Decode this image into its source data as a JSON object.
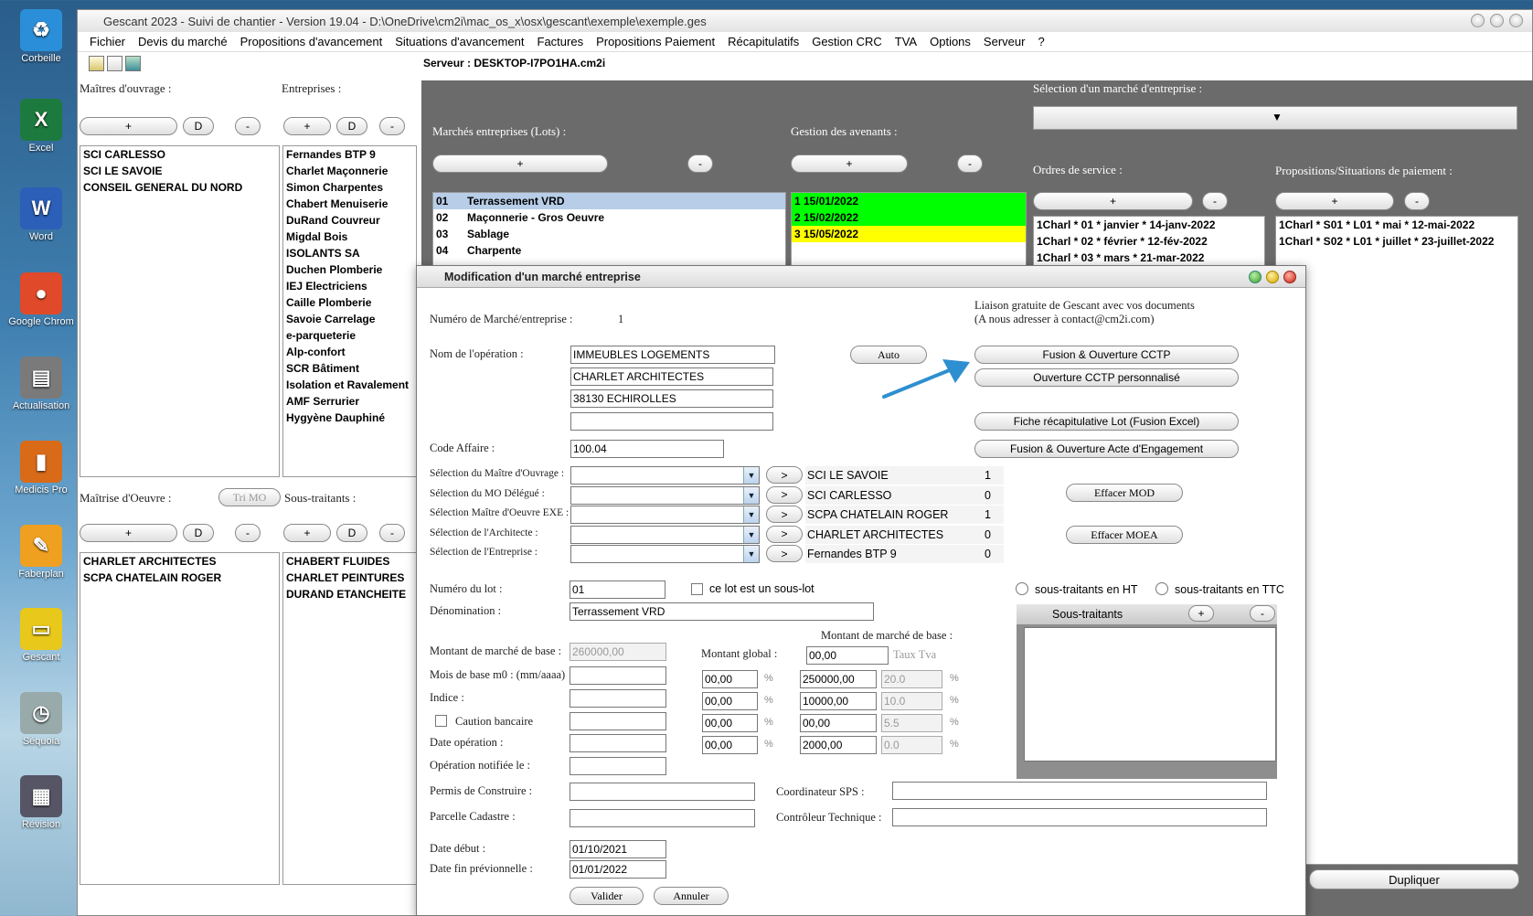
{
  "desktop": {
    "icons": [
      "Corbeille",
      "Excel",
      "Word",
      "Google Chrom",
      "Actualisation",
      "Medicis Pro",
      "Faberplan",
      "Gescant",
      "Séquoia",
      "Révision"
    ]
  },
  "window": {
    "title": "Gescant 2023 - Suivi de chantier - Version 19.04 - D:\\OneDrive\\cm2i\\mac_os_x\\osx\\gescant\\exemple\\exemple.ges"
  },
  "menu": [
    "Fichier",
    "Devis du marché",
    "Propositions d'avancement",
    "Situations d'avancement",
    "Factures",
    "Propositions Paiement",
    "Récapitulatifs",
    "Gestion CRC",
    "TVA",
    "Options",
    "Serveur",
    "?"
  ],
  "server": "Serveur : DESKTOP-I7PO1HA.cm2i",
  "left": {
    "maitres_label": "Maîtres d'ouvrage :",
    "entreprises_label": "Entreprises :",
    "plus": "+",
    "d": "D",
    "minus": "-",
    "maitres": [
      "SCI CARLESSO",
      "SCI LE SAVOIE",
      "CONSEIL GENERAL DU NORD"
    ],
    "entreprises": [
      "Fernandes BTP 9",
      "Charlet Maçonnerie",
      "Simon Charpentes",
      "Chabert Menuiserie",
      "DuRand Couvreur",
      "Migdal Bois",
      "ISOLANTS SA",
      "Duchen Plomberie",
      "IEJ Electriciens",
      "Caille Plomberie",
      "Savoie Carrelage",
      "e-parqueterie",
      "Alp-confort",
      "SCR Bâtiment",
      "Isolation et Ravalement",
      "AMF Serrurier",
      "Hygyène Dauphiné"
    ],
    "moe_label": "Maîtrise d'Oeuvre :",
    "tri_mo": "Tri MO",
    "sous_label": "Sous-traitants :",
    "moe": [
      "CHARLET ARCHITECTES",
      "SCPA CHATELAIN ROGER"
    ],
    "sous": [
      "CHABERT FLUIDES",
      "CHARLET PEINTURES",
      "DURAND ETANCHEITE"
    ]
  },
  "right": {
    "selection_label": "Sélection d'un marché d'entreprise :",
    "marches_label": "Marchés entreprises (Lots) :",
    "avenants_label": "Gestion des avenants :",
    "ordres_label": "Ordres de service :",
    "propositions_label": "Propositions/Situations de paiement :",
    "lots": [
      {
        "num": "01",
        "name": "Terrassement VRD"
      },
      {
        "num": "02",
        "name": "Maçonnerie - Gros Oeuvre"
      },
      {
        "num": "03",
        "name": "Sablage"
      },
      {
        "num": "04",
        "name": "Charpente"
      }
    ],
    "avenants": [
      "1 15/01/2022",
      "2 15/02/2022",
      "3 15/05/2022"
    ],
    "ordres": [
      "1Charl * 01 * janvier * 14-janv-2022",
      "1Charl * 02 * février * 12-fév-2022",
      "1Charl * 03 * mars * 21-mar-2022"
    ],
    "propositions": [
      "1Charl * S01 * L01 * mai * 12-mai-2022",
      "1Charl * S02 * L01 * juillet * 23-juillet-2022"
    ],
    "dupliquer": "Dupliquer"
  },
  "dialog": {
    "title": "Modification d'un marché entreprise",
    "liaison1": "Liaison gratuite de Gescant avec vos documents",
    "liaison2": "(A nous adresser à contact@cm2i.com)",
    "numero_label": "Numéro de Marché/entreprise :",
    "numero_value": "1",
    "nom_label": "Nom de l'opération :",
    "nom_lines": [
      "IMMEUBLES LOGEMENTS",
      "CHARLET ARCHITECTES",
      "38130 ECHIROLLES",
      ""
    ],
    "auto": "Auto",
    "btn_fusion_cctp": "Fusion & Ouverture CCTP",
    "btn_cctp_perso": "Ouverture CCTP personnalisé",
    "btn_fiche": "Fiche récapitulative Lot (Fusion Excel)",
    "btn_acte": "Fusion & Ouverture Acte d'Engagement",
    "code_label": "Code Affaire  :",
    "code_value": "100.04",
    "selections": [
      {
        "label": "Sélection du Maître d'Ouvrage :",
        "name": "SCI LE SAVOIE",
        "num": "1"
      },
      {
        "label": "Sélection du MO Délégué :",
        "name": "SCI CARLESSO",
        "num": "0"
      },
      {
        "label": "Sélection Maître d'Oeuvre EXE :",
        "name": "SCPA CHATELAIN ROGER",
        "num": "1"
      },
      {
        "label": "Sélection de l'Architecte :",
        "name": "CHARLET ARCHITECTES",
        "num": "0"
      },
      {
        "label": "Sélection de l'Entreprise :",
        "name": "Fernandes BTP 9",
        "num": "0"
      }
    ],
    "arrow_btn": ">",
    "effacer_mod": "Effacer MOD",
    "effacer_moea": "Effacer MOEA",
    "lot_label": "Numéro du lot :",
    "lot_value": "01",
    "sous_lot": "ce lot est un sous-lot",
    "radio_ht": "sous-traitants en HT",
    "radio_ttc": "sous-traitants en TTC",
    "denom_label": "Dénomination :",
    "denom_value": "Terrassement VRD",
    "sous_traitants_title": "Sous-traitants",
    "montant_base_header": "Montant de marché de base :",
    "montant_base_label": "Montant de marché de base :",
    "montant_base_value": "260000,00",
    "montant_global_label": "Montant global :",
    "montant_global_value": "00,00",
    "taux_tva": "Taux Tva",
    "mois_label": "Mois de base m0 : (mm/aaaa)",
    "indice_label": "Indice :",
    "caution_label": "Caution bancaire",
    "date_op_label": "Date opération :",
    "op_notifiee_label": "Opération notifiée le :",
    "rows": [
      {
        "pct": "00,00",
        "amount": "250000,00",
        "tva": "20.0"
      },
      {
        "pct": "00,00",
        "amount": "10000,00",
        "tva": "10.0"
      },
      {
        "pct": "00,00",
        "amount": "00,00",
        "tva": "5.5"
      },
      {
        "pct": "00,00",
        "amount": "2000,00",
        "tva": "0.0"
      }
    ],
    "pct_sign": "%",
    "permis_label": "Permis de Construire :",
    "coord_label": "Coordinateur SPS :",
    "parcelle_label": "Parcelle Cadastre :",
    "controleur_label": "Contrôleur Technique :",
    "date_debut_label": "Date début :",
    "date_debut": "01/10/2021",
    "date_fin_label": "Date fin prévionnelle :",
    "date_fin": "01/01/2022",
    "valider": "Valider",
    "annuler": "Annuler"
  },
  "colors": {
    "avenant_green": "#00ff00",
    "avenant_yellow": "#ffff00",
    "selected_row": "#b7cde8",
    "panel_grey": "#6b6b6b",
    "arrow_blue": "#2e8fd0"
  }
}
